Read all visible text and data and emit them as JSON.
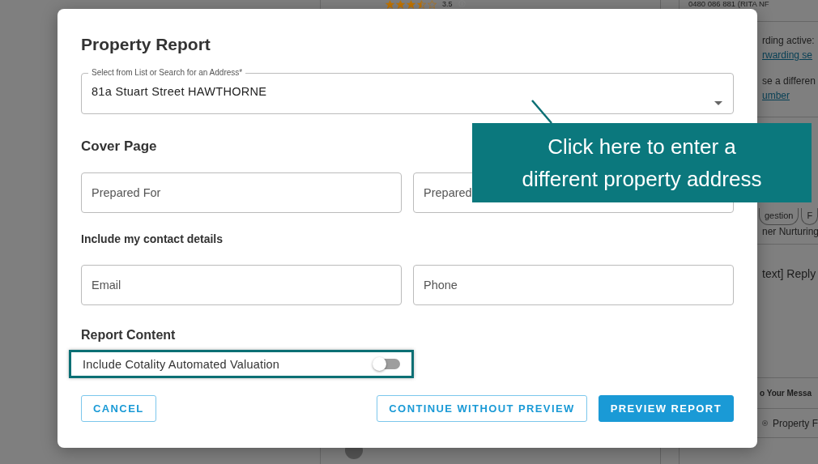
{
  "background": {
    "rating": {
      "stars": 3.5,
      "value": "3.5"
    },
    "contact_phone": "0480 086 881 (RITA NF",
    "forwarding_note": "rding active:",
    "forwarding_link": "rwarding se",
    "different_number_note": "se a differen",
    "different_number_link": "umber",
    "chips": [
      "gestion",
      "F"
    ],
    "nurturing_label": "ner Nurturing",
    "reply_text": "text] Reply",
    "messages_heading": "o Your Messa",
    "attachment_button": "Property F"
  },
  "dialog": {
    "title": "Property Report",
    "address_select": {
      "label": "Select from List or Search for an Address*",
      "value": "81a Stuart Street HAWTHORNE"
    },
    "cover_page": {
      "heading": "Cover Page",
      "fields": [
        {
          "placeholder": "Prepared For"
        },
        {
          "placeholder": "Prepared"
        }
      ]
    },
    "contact": {
      "heading": "Include my contact details",
      "fields": [
        {
          "placeholder": "Email"
        },
        {
          "placeholder": "Phone"
        }
      ]
    },
    "report_content": {
      "heading": "Report Content",
      "options": [
        {
          "label": "Include Cotality Automated Valuation",
          "on": false,
          "highlighted": true
        }
      ]
    },
    "buttons": [
      {
        "label": "CANCEL",
        "kind": "outline"
      },
      {
        "label": "CONTINUE WITHOUT PREVIEW",
        "kind": "outline"
      },
      {
        "label": "PREVIEW REPORT",
        "kind": "primary"
      }
    ]
  },
  "callout": {
    "lines": [
      "Click here to enter a",
      "different property address"
    ]
  }
}
